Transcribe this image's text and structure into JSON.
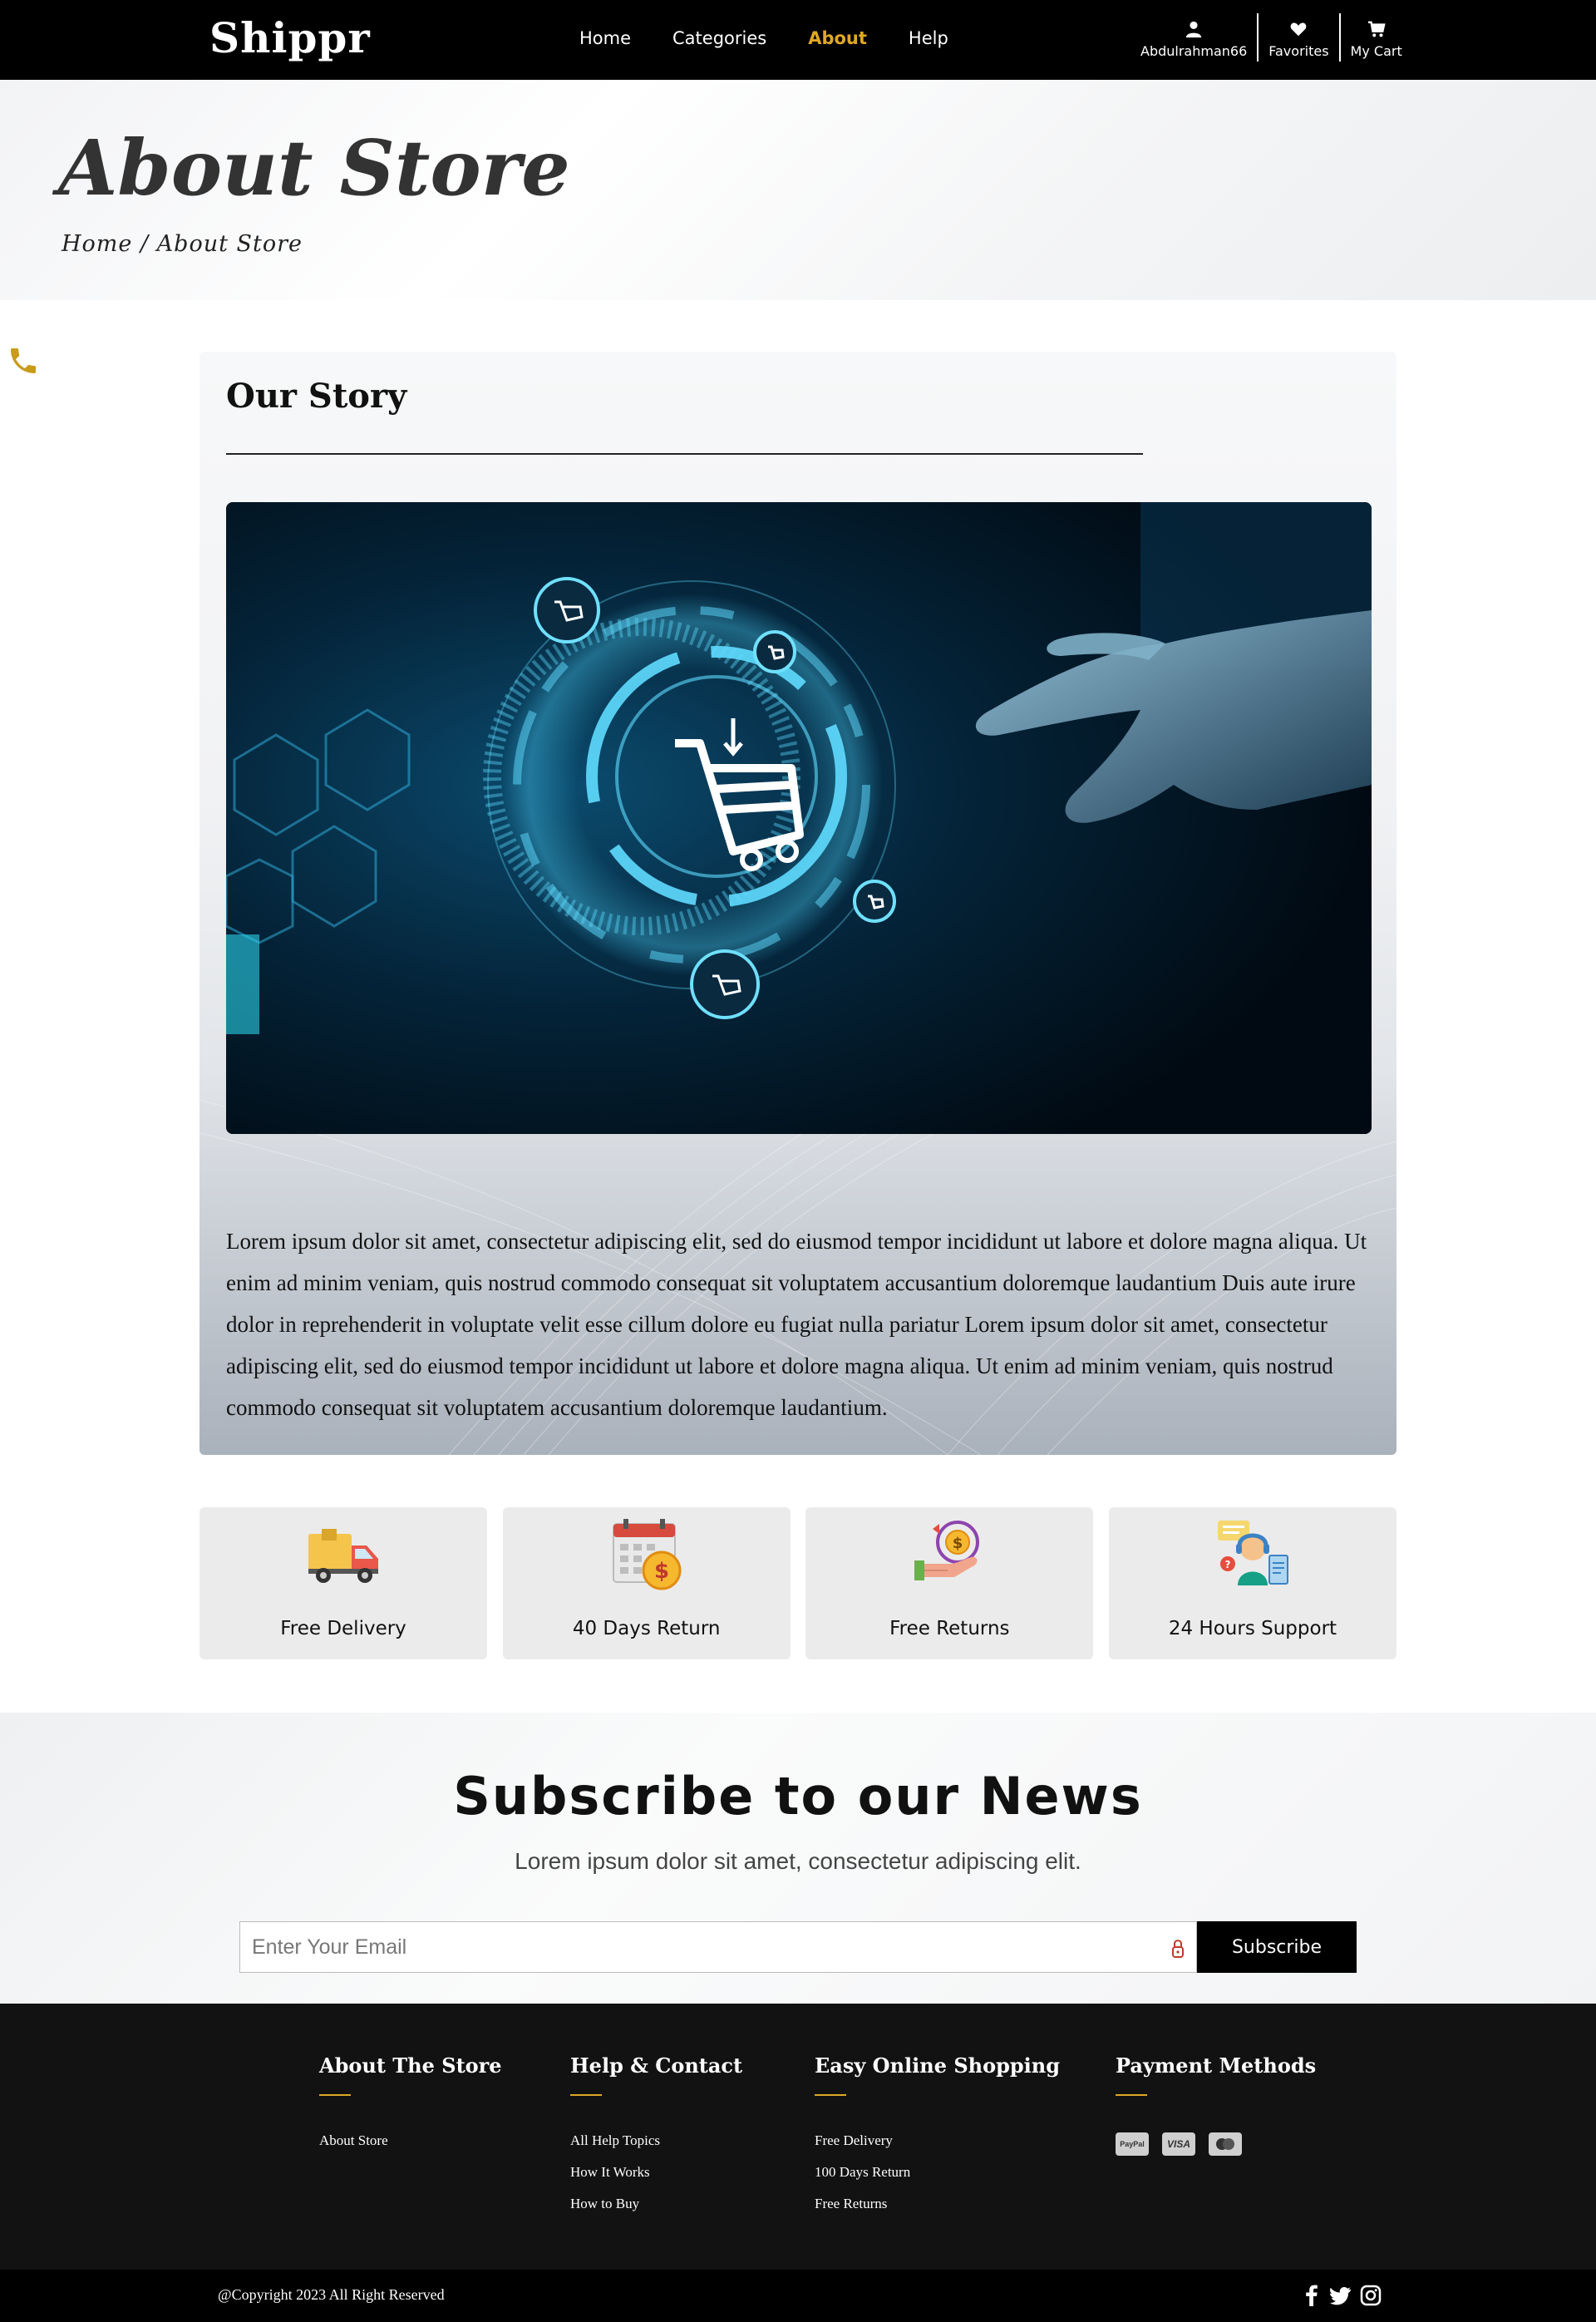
{
  "navbar": {
    "brand": "Shippr",
    "links": [
      {
        "label": "Home",
        "active": false
      },
      {
        "label": "Categories",
        "active": false
      },
      {
        "label": "About",
        "active": true
      },
      {
        "label": "Help",
        "active": false
      }
    ],
    "user": {
      "username": "Abdulrahman66",
      "favorites_label": "Favorites",
      "cart_label": "My Cart"
    }
  },
  "hero": {
    "title": "About Store",
    "breadcrumb": {
      "home": "Home",
      "separator": " / ",
      "current": "About Store"
    }
  },
  "story": {
    "title": "Our Story",
    "image_icon": "shopping-cart-hologram-image",
    "text": "Lorem ipsum dolor sit amet, consectetur adipiscing elit, sed do eiusmod tempor incididunt ut labore et dolore magna aliqua. Ut enim ad minim veniam, quis nostrud commodo consequat sit voluptatem accusantium doloremque laudantium Duis aute irure dolor in reprehenderit in voluptate velit esse cillum dolore eu fugiat nulla pariatur Lorem ipsum dolor sit amet, consectetur adipiscing elit, sed do eiusmod tempor incididunt ut labore et dolore magna aliqua. Ut enim ad minim veniam, quis nostrud commodo consequat sit voluptatem accusantium doloremque laudantium."
  },
  "features": [
    {
      "label": "Free Delivery",
      "icon": "delivery-truck-icon"
    },
    {
      "label": "40 Days Return",
      "icon": "calendar-dollar-icon"
    },
    {
      "label": "Free Returns",
      "icon": "hand-money-icon"
    },
    {
      "label": "24 Hours Support",
      "icon": "support-agent-icon"
    }
  ],
  "subscribe": {
    "title": "Subscribe to our News",
    "text": "Lorem ipsum dolor sit amet, consectetur adipiscing elit.",
    "placeholder": "Enter Your Email",
    "button": "Subscribe"
  },
  "footer": {
    "columns": [
      {
        "heading": "About The Store",
        "links": [
          "About Store"
        ]
      },
      {
        "heading": "Help & Contact",
        "links": [
          "All Help Topics",
          "How It Works",
          "How to Buy"
        ]
      },
      {
        "heading": "Easy Online Shopping",
        "links": [
          "Free Delivery",
          "100 Days Return",
          "Free Returns"
        ]
      },
      {
        "heading": "Payment Methods",
        "payments": [
          "PayPal",
          "VISA",
          "mastercard"
        ]
      }
    ],
    "copyright": "@Copyright 2023 All Right Reserved",
    "socials": [
      "facebook-icon",
      "twitter-icon",
      "instagram-icon"
    ]
  },
  "colors": {
    "accent": "#e0a727",
    "navbar_bg": "#000000",
    "footer_bg": "#121212"
  }
}
